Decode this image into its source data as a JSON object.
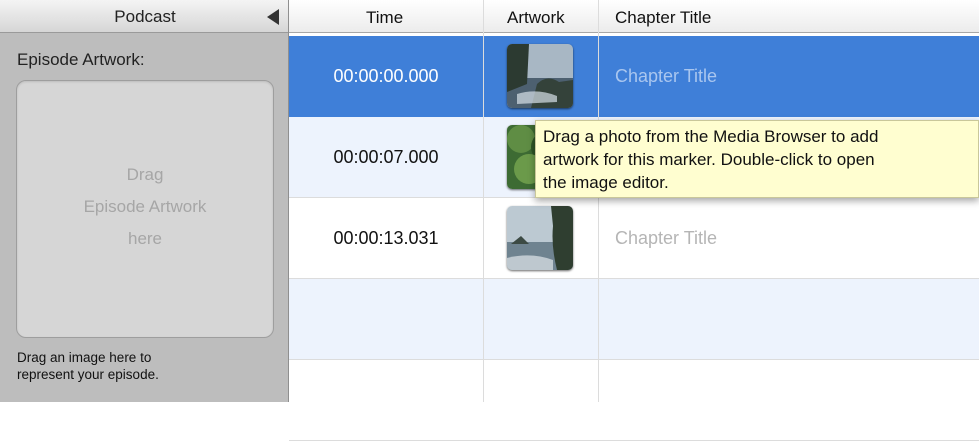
{
  "sidebar": {
    "title": "Podcast",
    "artwork_label": "Episode Artwork:",
    "drop_lines": [
      "Drag",
      "Episode Artwork",
      "here"
    ],
    "hint_lines": [
      "Drag an image here to",
      "represent your episode."
    ]
  },
  "table": {
    "columns": [
      "Time",
      "Artwork",
      "Chapter Title"
    ],
    "rows": [
      {
        "time": "00:00:00.000",
        "title": "Chapter Title",
        "selected": true
      },
      {
        "time": "00:00:07.000",
        "title": "",
        "selected": false
      },
      {
        "time": "00:00:13.031",
        "title": "Chapter Title",
        "selected": false
      }
    ]
  },
  "tooltip": {
    "lines": [
      "Drag a photo from the Media Browser to add",
      "artwork for this marker. Double-click to open",
      "the image editor."
    ]
  },
  "colors": {
    "selection": "#3f7fd8",
    "sidebar": "#bdbdbd",
    "tooltip": "#fffed0"
  },
  "icons": {
    "collapse": "triangle-left-icon"
  }
}
